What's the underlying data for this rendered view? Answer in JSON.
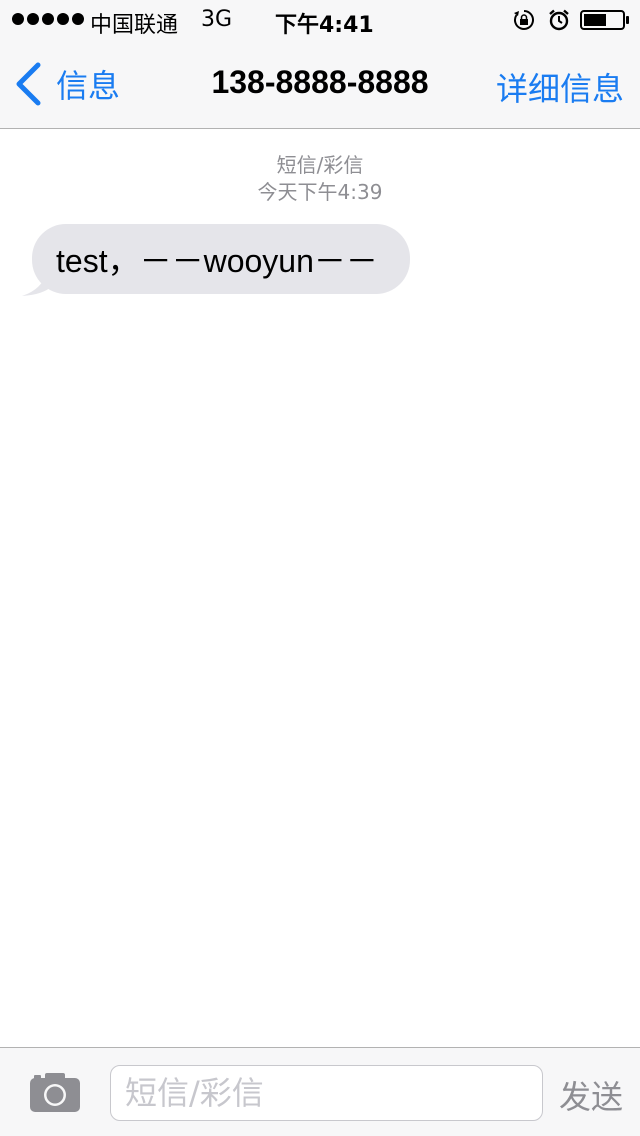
{
  "status_bar": {
    "signal_dots": 5,
    "carrier": "中国联通",
    "network": "3G",
    "time": "下午4:41",
    "icons": [
      "rotation-lock-icon",
      "alarm-icon",
      "battery-icon"
    ],
    "battery_level": 0.6
  },
  "nav": {
    "back_label": "信息",
    "title": "138-8888-8888",
    "details_label": "详细信息"
  },
  "thread": {
    "service_label": "短信/彩信",
    "timestamp": "今天下午4:39",
    "messages": [
      {
        "direction": "incoming",
        "text": "test，－－wooyun－－"
      }
    ]
  },
  "input_bar": {
    "placeholder": "短信/彩信",
    "value": "",
    "send_label": "发送",
    "camera_icon": "camera-icon"
  },
  "colors": {
    "accent": "#1a7cf1",
    "bubble_incoming": "#e5e5ea",
    "bar_background": "#f7f7f8",
    "meta_text": "#8e8e93"
  }
}
